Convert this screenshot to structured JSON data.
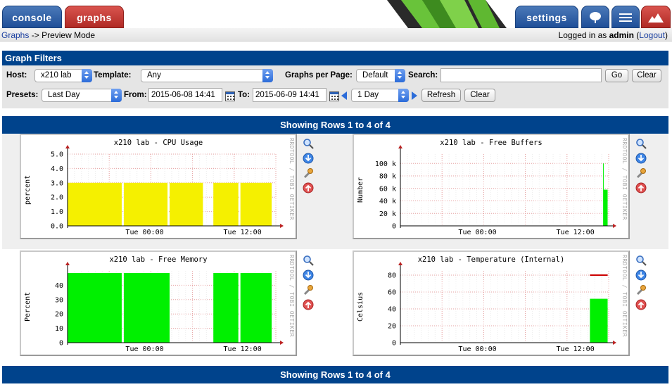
{
  "nav": {
    "console_label": "console",
    "graphs_label": "graphs",
    "settings_label": "settings"
  },
  "breadcrumb": {
    "graphs_link": "Graphs",
    "separator": "->",
    "mode": "Preview Mode"
  },
  "auth": {
    "prefix": "Logged in as",
    "user": "admin",
    "logout": "Logout"
  },
  "filters": {
    "title": "Graph Filters",
    "host_label": "Host:",
    "host_value": "x210 lab",
    "template_label": "Template:",
    "template_value": "Any",
    "gpp_label": "Graphs per Page:",
    "gpp_value": "Default",
    "search_label": "Search:",
    "search_value": "",
    "go_label": "Go",
    "clear_label": "Clear",
    "presets_label": "Presets:",
    "presets_value": "Last Day",
    "from_label": "From:",
    "from_value": "2015-06-08 14:41",
    "to_label": "To:",
    "to_value": "2015-06-09 14:41",
    "span_value": "1 Day",
    "refresh_label": "Refresh",
    "clear2_label": "Clear"
  },
  "rows_text": "Showing Rows 1 to 4 of 4",
  "side_text": "RRDTOOL / TOBI OETIKER",
  "colors": {
    "header_blue": "#00438c",
    "cpu_fill": "#f5f000",
    "green_fill": "#00f000",
    "line_red": "#cc0000"
  },
  "graphs": [
    {
      "title": "x210 lab - CPU Usage",
      "ylabel": "percent",
      "yticks": [
        "5.0",
        "4.0",
        "3.0",
        "2.0",
        "1.0",
        "0.0"
      ],
      "xticks": [
        "Tue 00:00",
        "Tue 12:00"
      ],
      "chart_data": {
        "type": "area",
        "ylim": [
          0,
          5
        ],
        "series": [
          {
            "values_by_block": [
              {
                "x": [
                  0.0,
                  0.26
                ],
                "y": 3.0
              },
              {
                "x": [
                  0.27,
                  0.48
                ],
                "y": 3.0
              },
              {
                "x": [
                  0.49,
                  0.65
                ],
                "y": 3.0
              },
              {
                "x": [
                  0.7,
                  0.82
                ],
                "y": 3.0
              },
              {
                "x": [
                  0.83,
                  0.98
                ],
                "y": 3.0
              }
            ]
          }
        ],
        "fill": "cpu"
      }
    },
    {
      "title": "x210 lab - Free Buffers",
      "ylabel": "Number",
      "yticks": [
        "100 k",
        "80 k",
        "60 k",
        "40 k",
        "20 k",
        "0"
      ],
      "xticks": [
        "Tue 00:00",
        "Tue 12:00"
      ],
      "chart_data": {
        "type": "area",
        "ylim": [
          0,
          115
        ],
        "series": [
          {
            "values_by_block": [
              {
                "x": [
                  0.975,
                  0.995
                ],
                "y": 58
              }
            ]
          }
        ],
        "spike": {
          "x": 0.975,
          "y": 100
        },
        "fill": "green"
      }
    },
    {
      "title": "x210 lab - Free Memory",
      "ylabel": "Percent",
      "yticks": [
        "40",
        "30",
        "20",
        "10",
        "0"
      ],
      "xticks": [
        "Tue 00:00",
        "Tue 12:00"
      ],
      "chart_data": {
        "type": "area",
        "ylim": [
          0,
          50
        ],
        "series": [
          {
            "values_by_block": [
              {
                "x": [
                  0.0,
                  0.26
                ],
                "y": 48.5
              },
              {
                "x": [
                  0.27,
                  0.49
                ],
                "y": 48.5
              },
              {
                "x": [
                  0.7,
                  0.82
                ],
                "y": 48.5
              },
              {
                "x": [
                  0.83,
                  0.98
                ],
                "y": 48.5
              }
            ]
          }
        ],
        "fill": "green"
      }
    },
    {
      "title": "x210 lab - Temperature (Internal)",
      "ylabel": "Celsius",
      "yticks": [
        "80",
        "60",
        "40",
        "20",
        "0"
      ],
      "xticks": [
        "Tue 00:00",
        "Tue 12:00"
      ],
      "chart_data": {
        "type": "area",
        "ylim": [
          0,
          85
        ],
        "series": [
          {
            "values_by_block": [
              {
                "x": [
                  0.91,
                  0.995
                ],
                "y": 52
              }
            ]
          }
        ],
        "line": {
          "x": [
            0.91,
            0.995
          ],
          "y": 80
        },
        "fill": "green"
      }
    }
  ]
}
